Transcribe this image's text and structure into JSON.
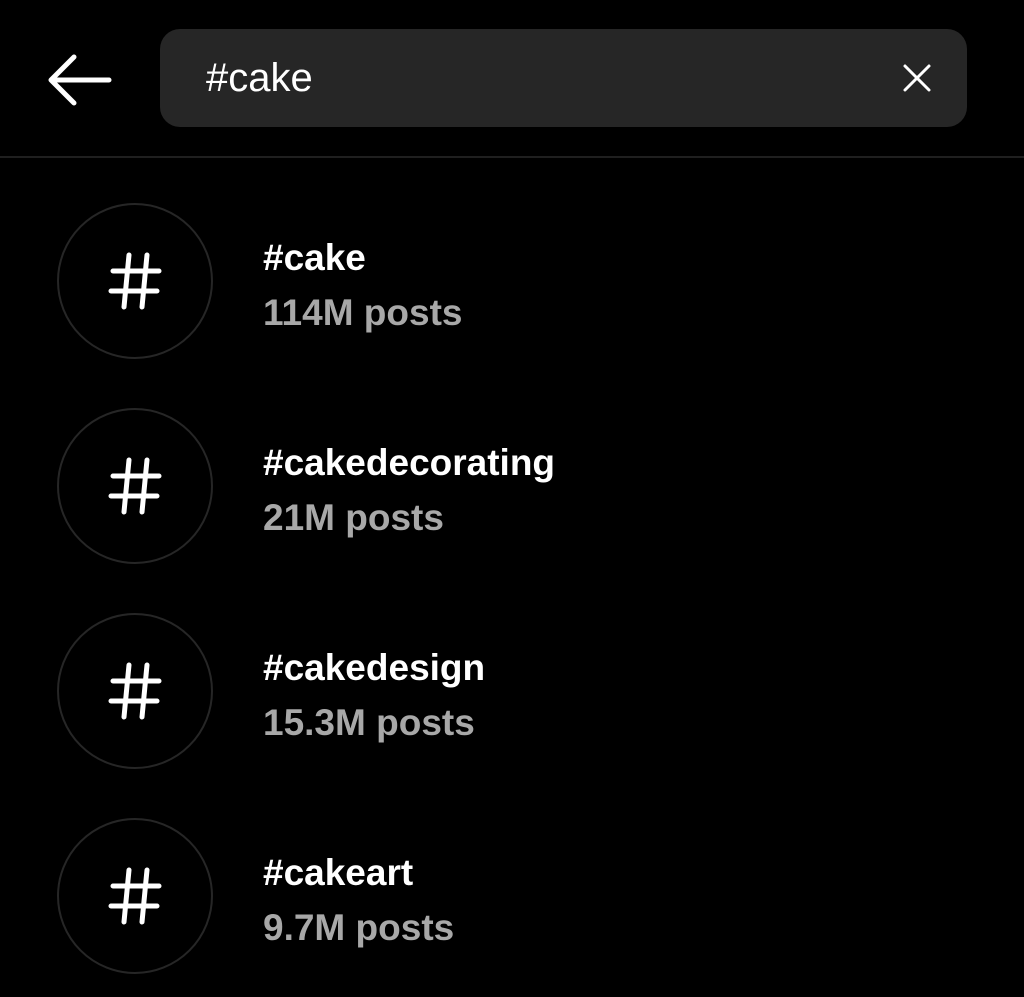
{
  "search": {
    "query": "#cake"
  },
  "icons": {
    "back": "arrow-left-icon",
    "clear": "close-icon",
    "hashtag": "hashtag-icon"
  },
  "colors": {
    "background": "#000000",
    "search_field": "#262626",
    "primary_text": "#ffffff",
    "secondary_text": "#a8a8a8"
  },
  "results": [
    {
      "tag": "#cake",
      "posts": "114M posts"
    },
    {
      "tag": "#cakedecorating",
      "posts": "21M posts"
    },
    {
      "tag": "#cakedesign",
      "posts": "15.3M posts"
    },
    {
      "tag": "#cakeart",
      "posts": "9.7M posts"
    }
  ]
}
